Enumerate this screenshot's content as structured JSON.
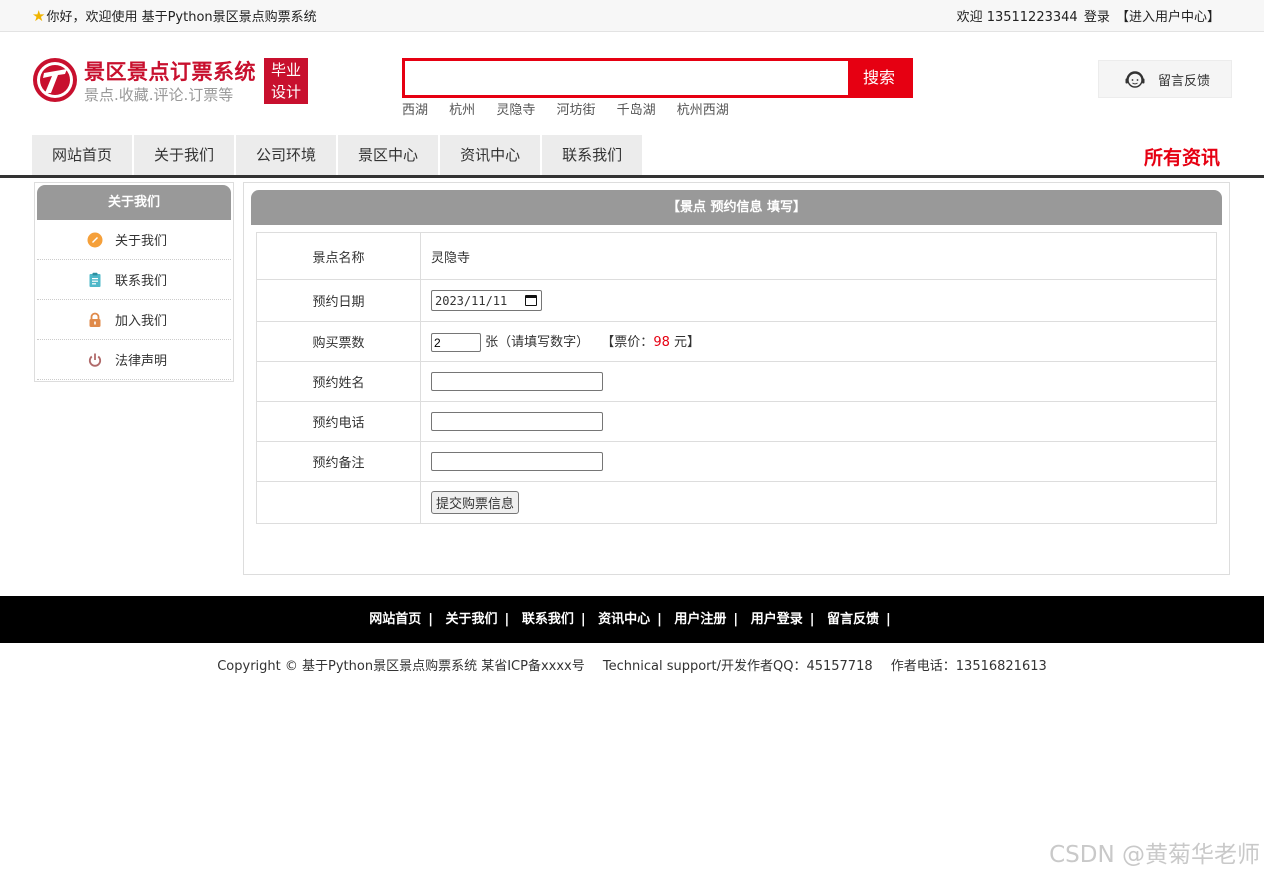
{
  "topbar": {
    "welcome": "你好，欢迎使用 基于Python景区景点购票系统",
    "user_greeting": "欢迎 13511223344",
    "login_link": "登录",
    "user_center_link": "【进入用户中心】"
  },
  "logo": {
    "title": "景区景点订票系统",
    "subtitle": "景点.收藏.评论.订票等",
    "badge_line1": "毕业",
    "badge_line2": "设计"
  },
  "search": {
    "value": "",
    "button_label": "搜索",
    "hotwords": [
      "西湖",
      "杭州",
      "灵隐寺",
      "河坊街",
      "千岛湖",
      "杭州西湖"
    ]
  },
  "feedback": {
    "label": "留言反馈"
  },
  "nav": {
    "items": [
      "网站首页",
      "关于我们",
      "公司环境",
      "景区中心",
      "资讯中心",
      "联系我们"
    ],
    "all_news": "所有资讯"
  },
  "sidebar": {
    "title": "关于我们",
    "items": [
      {
        "label": "关于我们",
        "icon": "about-icon",
        "color": "#f5a03a"
      },
      {
        "label": "联系我们",
        "icon": "clipboard-icon",
        "color": "#4fb8c9"
      },
      {
        "label": "加入我们",
        "icon": "lock-icon",
        "color": "#e08a4a"
      },
      {
        "label": "法律声明",
        "icon": "power-icon",
        "color": "#b06a6a"
      }
    ]
  },
  "form": {
    "title": "【景点 预约信息 填写】",
    "spot_label": "景点名称",
    "spot_value": "灵隐寺",
    "date_label": "预约日期",
    "date_value": "2023/11/11",
    "qty_label": "购买票数",
    "qty_value": "2",
    "qty_hint": "张（请填写数字）",
    "price_prefix": "【票价：",
    "price_value": "98",
    "price_suffix": "元】",
    "name_label": "预约姓名",
    "phone_label": "预约电话",
    "note_label": "预约备注",
    "submit_label": "提交购票信息"
  },
  "footer": {
    "links": [
      "网站首页",
      "关于我们",
      "联系我们",
      "资讯中心",
      "用户注册",
      "用户登录",
      "留言反馈"
    ],
    "separator": "|",
    "copyright": "Copyright © 基于Python景区景点购票系统 某省ICP备xxxx号",
    "support": "Technical support/开发作者QQ：45157718",
    "phone": "作者电话：13516821613"
  },
  "watermark": "CSDN @黄菊华老师",
  "colors": {
    "brand_red": "#c8102e",
    "search_red": "#e60012",
    "panel_gray": "#999999"
  }
}
